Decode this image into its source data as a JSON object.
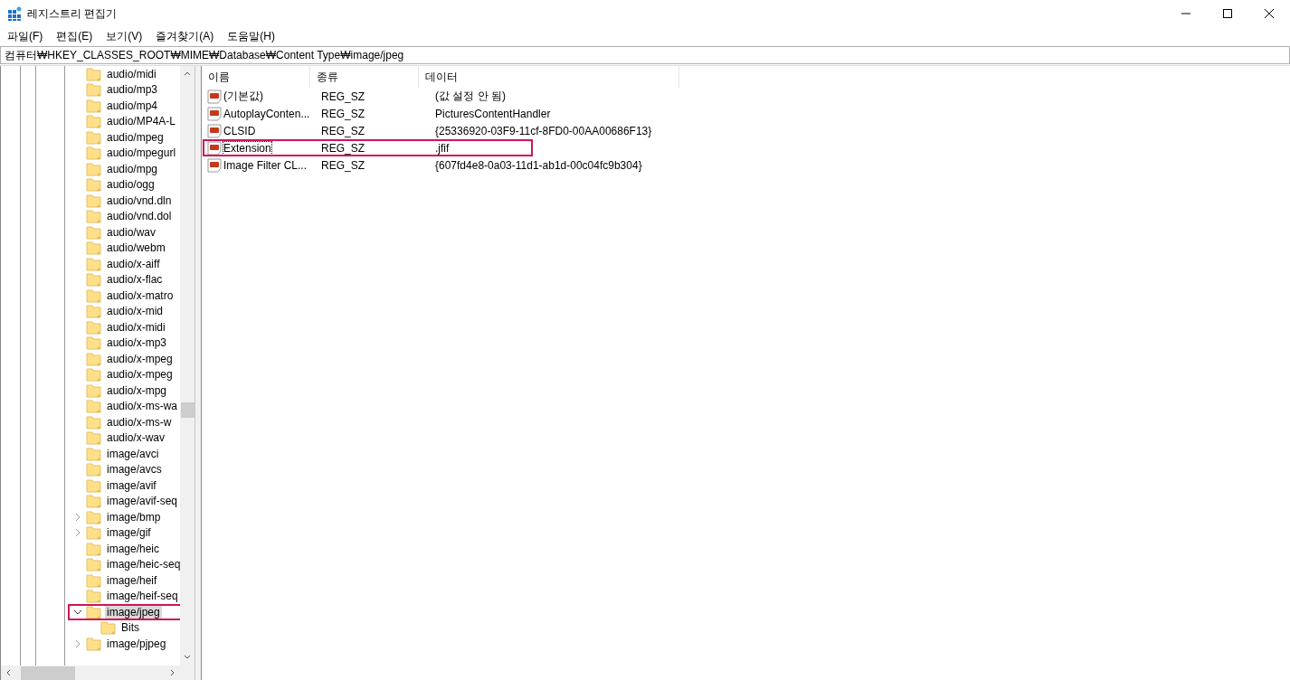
{
  "window": {
    "title": "레지스트리 편집기"
  },
  "menu": [
    "파일(F)",
    "편집(E)",
    "보기(V)",
    "즐겨찾기(A)",
    "도움말(H)"
  ],
  "address": "컴퓨터₩HKEY_CLASSES_ROOT₩MIME₩Database₩Content Type₩image/jpeg",
  "tree": [
    {
      "label": "audio/midi",
      "expandable": false,
      "selected": false,
      "annotated": false
    },
    {
      "label": "audio/mp3",
      "expandable": false,
      "selected": false,
      "annotated": false
    },
    {
      "label": "audio/mp4",
      "expandable": false,
      "selected": false,
      "annotated": false
    },
    {
      "label": "audio/MP4A-L",
      "expandable": false,
      "selected": false,
      "annotated": false
    },
    {
      "label": "audio/mpeg",
      "expandable": false,
      "selected": false,
      "annotated": false
    },
    {
      "label": "audio/mpegurl",
      "expandable": false,
      "selected": false,
      "annotated": false
    },
    {
      "label": "audio/mpg",
      "expandable": false,
      "selected": false,
      "annotated": false
    },
    {
      "label": "audio/ogg",
      "expandable": false,
      "selected": false,
      "annotated": false
    },
    {
      "label": "audio/vnd.dln",
      "expandable": false,
      "selected": false,
      "annotated": false
    },
    {
      "label": "audio/vnd.dol",
      "expandable": false,
      "selected": false,
      "annotated": false
    },
    {
      "label": "audio/wav",
      "expandable": false,
      "selected": false,
      "annotated": false
    },
    {
      "label": "audio/webm",
      "expandable": false,
      "selected": false,
      "annotated": false
    },
    {
      "label": "audio/x-aiff",
      "expandable": false,
      "selected": false,
      "annotated": false
    },
    {
      "label": "audio/x-flac",
      "expandable": false,
      "selected": false,
      "annotated": false
    },
    {
      "label": "audio/x-matro",
      "expandable": false,
      "selected": false,
      "annotated": false
    },
    {
      "label": "audio/x-mid",
      "expandable": false,
      "selected": false,
      "annotated": false
    },
    {
      "label": "audio/x-midi",
      "expandable": false,
      "selected": false,
      "annotated": false
    },
    {
      "label": "audio/x-mp3",
      "expandable": false,
      "selected": false,
      "annotated": false
    },
    {
      "label": "audio/x-mpeg",
      "expandable": false,
      "selected": false,
      "annotated": false
    },
    {
      "label": "audio/x-mpeg",
      "expandable": false,
      "selected": false,
      "annotated": false
    },
    {
      "label": "audio/x-mpg",
      "expandable": false,
      "selected": false,
      "annotated": false
    },
    {
      "label": "audio/x-ms-wa",
      "expandable": false,
      "selected": false,
      "annotated": false
    },
    {
      "label": "audio/x-ms-w",
      "expandable": false,
      "selected": false,
      "annotated": false
    },
    {
      "label": "audio/x-wav",
      "expandable": false,
      "selected": false,
      "annotated": false
    },
    {
      "label": "image/avci",
      "expandable": false,
      "selected": false,
      "annotated": false
    },
    {
      "label": "image/avcs",
      "expandable": false,
      "selected": false,
      "annotated": false
    },
    {
      "label": "image/avif",
      "expandable": false,
      "selected": false,
      "annotated": false
    },
    {
      "label": "image/avif-seq",
      "expandable": false,
      "selected": false,
      "annotated": false
    },
    {
      "label": "image/bmp",
      "expandable": true,
      "expanded": false,
      "selected": false,
      "annotated": false
    },
    {
      "label": "image/gif",
      "expandable": true,
      "expanded": false,
      "selected": false,
      "annotated": false
    },
    {
      "label": "image/heic",
      "expandable": false,
      "selected": false,
      "annotated": false
    },
    {
      "label": "image/heic-seq",
      "expandable": false,
      "selected": false,
      "annotated": false
    },
    {
      "label": "image/heif",
      "expandable": false,
      "selected": false,
      "annotated": false
    },
    {
      "label": "image/heif-seq",
      "expandable": false,
      "selected": false,
      "annotated": false
    },
    {
      "label": "image/jpeg",
      "expandable": true,
      "expanded": true,
      "selected": true,
      "annotated": true,
      "children": [
        {
          "label": "Bits",
          "expandable": false,
          "selected": false,
          "annotated": false
        }
      ]
    },
    {
      "label": "image/pjpeg",
      "expandable": true,
      "expanded": false,
      "selected": false,
      "annotated": false
    }
  ],
  "values": {
    "columns": [
      "이름",
      "종류",
      "데이터"
    ],
    "rows": [
      {
        "name": "(기본값)",
        "type": "REG_SZ",
        "data": "(값 설정 안 됨)",
        "focused": false,
        "annotated": false
      },
      {
        "name": "AutoplayConten...",
        "type": "REG_SZ",
        "data": "PicturesContentHandler",
        "focused": false,
        "annotated": false
      },
      {
        "name": "CLSID",
        "type": "REG_SZ",
        "data": "{25336920-03F9-11cf-8FD0-00AA00686F13}",
        "focused": false,
        "annotated": false
      },
      {
        "name": "Extension",
        "type": "REG_SZ",
        "data": ".jfif",
        "focused": true,
        "annotated": true
      },
      {
        "name": "Image Filter CL...",
        "type": "REG_SZ",
        "data": "{607fd4e8-0a03-11d1-ab1d-00c04fc9b304}",
        "focused": false,
        "annotated": false
      }
    ]
  }
}
